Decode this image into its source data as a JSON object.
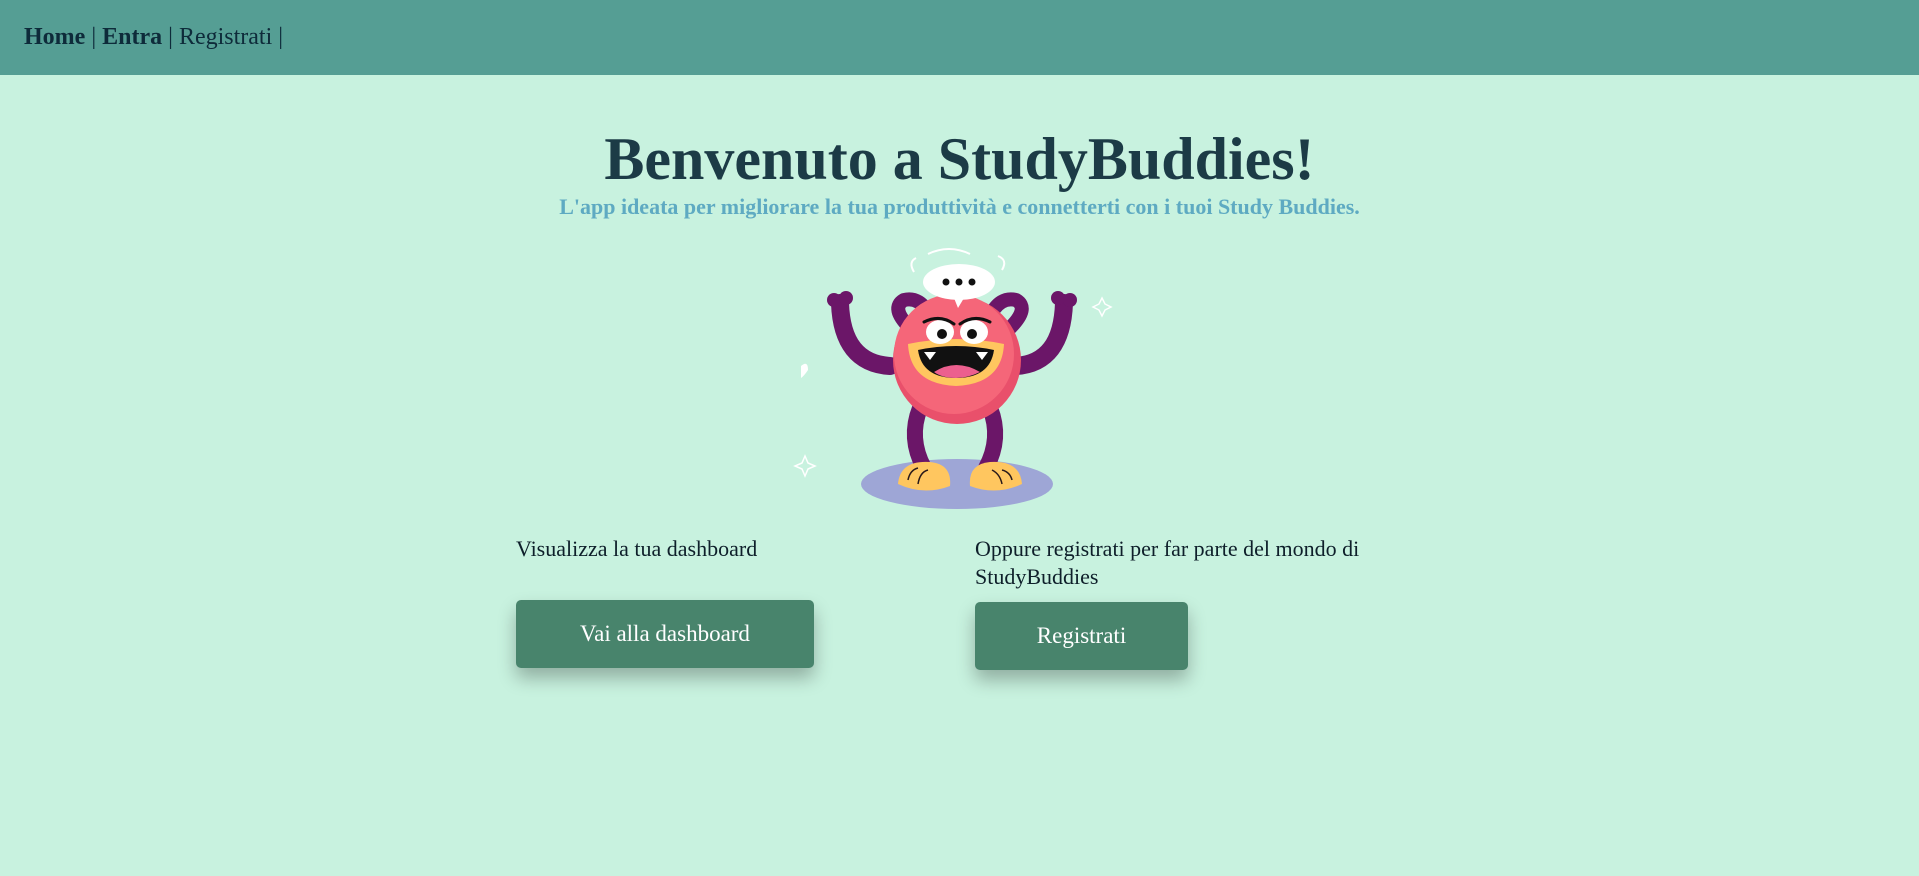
{
  "nav": {
    "home": "Home",
    "login": "Entra",
    "register": "Registrati",
    "separator": "|"
  },
  "hero": {
    "title": "Benvenuto a StudyBuddies!",
    "subtitle": "L'app ideata per migliorare la tua produttività e connetterti con i tuoi Study Buddies."
  },
  "dashboard": {
    "text": "Visualizza la tua dashboard",
    "button": "Vai alla dashboard"
  },
  "signup": {
    "text": "Oppure registrati per far parte del mondo di StudyBuddies",
    "button": "Registrati"
  },
  "icons": {
    "mascot": "monster-mascot-illustration"
  },
  "colors": {
    "background": "#c8f2df",
    "navbar": "#559e94",
    "button": "#48846c",
    "title": "#1c3b46",
    "subtitle": "#5eaac2"
  }
}
